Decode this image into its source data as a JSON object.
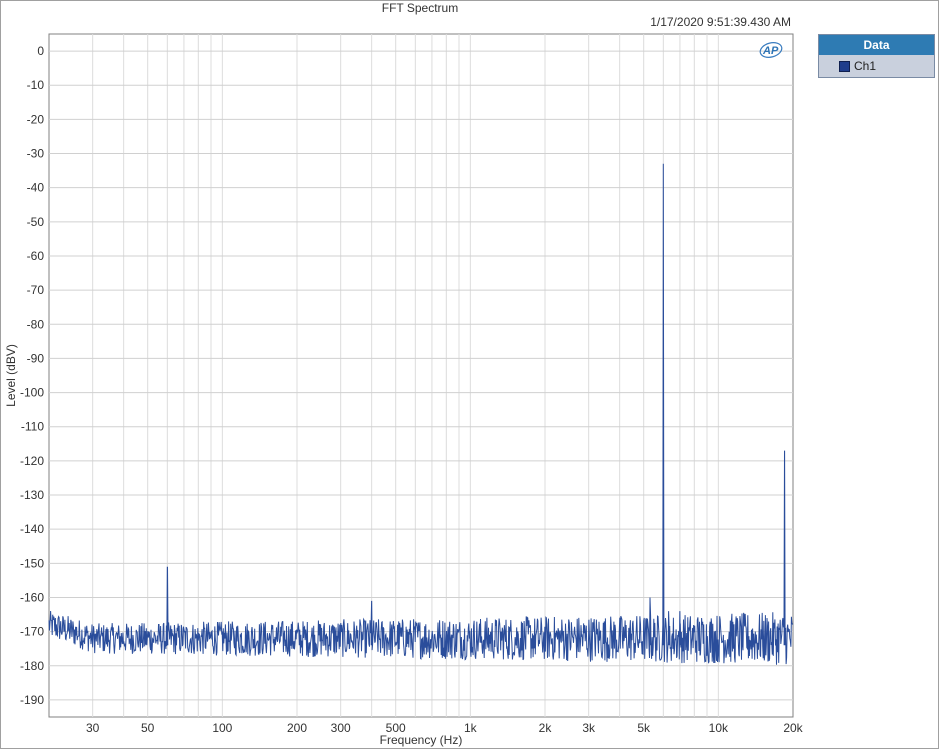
{
  "window": {
    "title": "FFT Spectrum",
    "timestamp": "1/17/2020 9:51:39.430 AM",
    "logo_text": "AP"
  },
  "legend": {
    "header": "Data",
    "items": [
      {
        "label": "Ch1",
        "color": "#1f3d8c"
      }
    ]
  },
  "chart_data": {
    "type": "line",
    "title": "FFT Spectrum",
    "xlabel": "Frequency (Hz)",
    "ylabel": "Level (dBV)",
    "xscale": "log",
    "xlim": [
      20,
      20000
    ],
    "ylim": [
      -195,
      5
    ],
    "grid": true,
    "legend_placement": "right-outside",
    "x_ticks": [
      {
        "value": 30,
        "label": "30"
      },
      {
        "value": 50,
        "label": "50"
      },
      {
        "value": 100,
        "label": "100"
      },
      {
        "value": 200,
        "label": "200"
      },
      {
        "value": 300,
        "label": "300"
      },
      {
        "value": 500,
        "label": "500"
      },
      {
        "value": 1000,
        "label": "1k"
      },
      {
        "value": 2000,
        "label": "2k"
      },
      {
        "value": 3000,
        "label": "3k"
      },
      {
        "value": 5000,
        "label": "5k"
      },
      {
        "value": 10000,
        "label": "10k"
      },
      {
        "value": 20000,
        "label": "20k"
      }
    ],
    "y_ticks": [
      {
        "value": 0,
        "label": "0"
      },
      {
        "value": -10,
        "label": "-10"
      },
      {
        "value": -20,
        "label": "-20"
      },
      {
        "value": -30,
        "label": "-30"
      },
      {
        "value": -40,
        "label": "-40"
      },
      {
        "value": -50,
        "label": "-50"
      },
      {
        "value": -60,
        "label": "-60"
      },
      {
        "value": -70,
        "label": "-70"
      },
      {
        "value": -80,
        "label": "-80"
      },
      {
        "value": -90,
        "label": "-90"
      },
      {
        "value": -100,
        "label": "-100"
      },
      {
        "value": -110,
        "label": "-110"
      },
      {
        "value": -120,
        "label": "-120"
      },
      {
        "value": -130,
        "label": "-130"
      },
      {
        "value": -140,
        "label": "-140"
      },
      {
        "value": -150,
        "label": "-150"
      },
      {
        "value": -160,
        "label": "-160"
      },
      {
        "value": -170,
        "label": "-170"
      },
      {
        "value": -180,
        "label": "-180"
      },
      {
        "value": -190,
        "label": "-190"
      }
    ],
    "series": [
      {
        "name": "Ch1",
        "color": "#2a4d9b",
        "noise_floor_dbv": -172,
        "noise_spread_db": 6,
        "peaks": [
          {
            "x": 60,
            "y": -151
          },
          {
            "x": 400,
            "y": -161
          },
          {
            "x": 5300,
            "y": -160
          },
          {
            "x": 6000,
            "y": -33
          },
          {
            "x": 6300,
            "y": -164
          },
          {
            "x": 7000,
            "y": -164
          },
          {
            "x": 18500,
            "y": -117
          }
        ]
      }
    ]
  }
}
